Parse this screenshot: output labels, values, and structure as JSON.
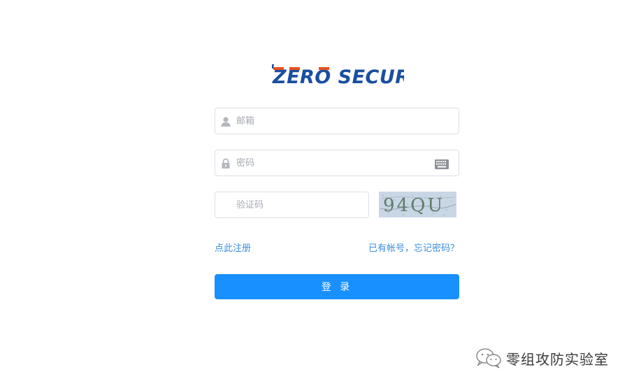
{
  "brand": {
    "logo_text": "ZERO SECURITY",
    "logo_color": "#1a4fa0",
    "logo_accent_color": "#e8501e"
  },
  "form": {
    "email": {
      "placeholder": "邮箱",
      "value": "",
      "icon": "user-icon"
    },
    "password": {
      "placeholder": "密码",
      "value": "",
      "icon": "lock-icon",
      "trailing_icon": "keyboard-icon"
    },
    "captcha": {
      "placeholder": "验证码",
      "value": "",
      "image_text": "94QU"
    }
  },
  "links": {
    "register": "点此注册",
    "forgot": "已有帐号，忘记密码？"
  },
  "login_button": {
    "label": "登 录",
    "color": "#1890ff"
  },
  "watermark": {
    "text": "零组攻防实验室",
    "icon": "wechat-icon"
  }
}
